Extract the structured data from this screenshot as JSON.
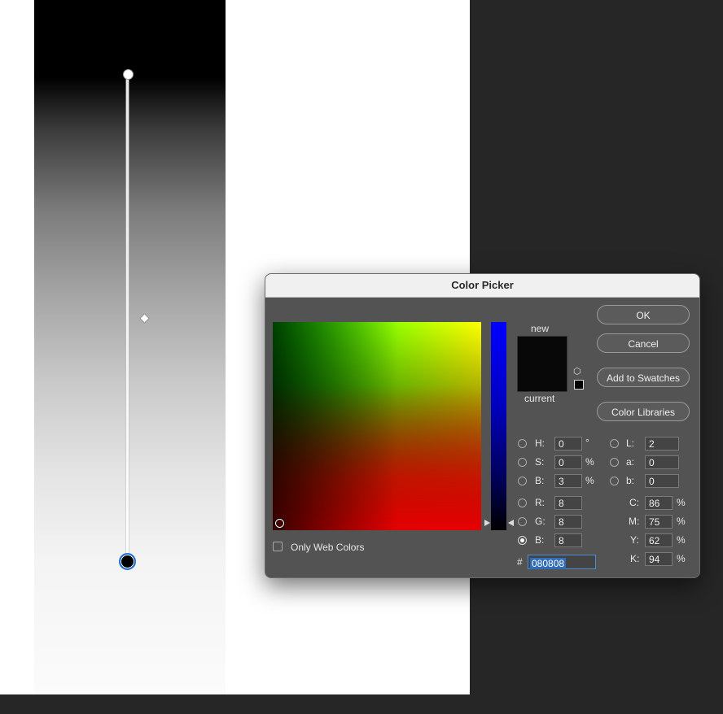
{
  "dialog": {
    "title": "Color Picker",
    "buttons": {
      "ok": "OK",
      "cancel": "Cancel",
      "add_to_swatches": "Add to Swatches",
      "color_libraries": "Color Libraries"
    },
    "swatch": {
      "new_label": "new",
      "current_label": "current",
      "new_color": "#080808",
      "current_color": "#080808"
    },
    "only_web_colors": {
      "label": "Only Web Colors",
      "checked": false
    },
    "hsb": {
      "h": {
        "label": "H:",
        "value": "0",
        "unit": "°"
      },
      "s": {
        "label": "S:",
        "value": "0",
        "unit": "%"
      },
      "b": {
        "label": "B:",
        "value": "3",
        "unit": "%"
      }
    },
    "rgb": {
      "r": {
        "label": "R:",
        "value": "8"
      },
      "g": {
        "label": "G:",
        "value": "8"
      },
      "b": {
        "label": "B:",
        "value": "8",
        "selected": true
      }
    },
    "lab": {
      "l": {
        "label": "L:",
        "value": "2"
      },
      "a": {
        "label": "a:",
        "value": "0"
      },
      "b": {
        "label": "b:",
        "value": "0"
      }
    },
    "cmyk": {
      "c": {
        "label": "C:",
        "value": "86",
        "unit": "%"
      },
      "m": {
        "label": "M:",
        "value": "75",
        "unit": "%"
      },
      "y": {
        "label": "Y:",
        "value": "62",
        "unit": "%"
      },
      "k": {
        "label": "K:",
        "value": "94",
        "unit": "%"
      }
    },
    "hex": {
      "label": "#",
      "value": "080808"
    },
    "icons": [
      "cube-icon",
      "websafe-icon"
    ]
  },
  "gradient": {
    "stops": [
      "#000000",
      "#ffffff"
    ],
    "selected_stop": "bottom"
  }
}
